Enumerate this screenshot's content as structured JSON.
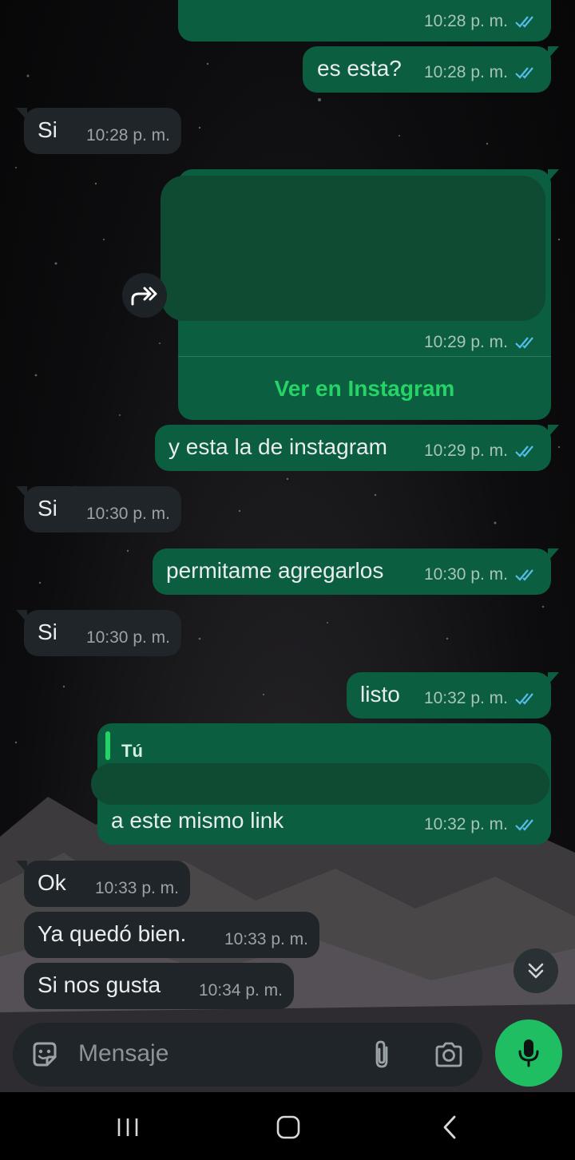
{
  "messages": [
    {
      "id": "m0",
      "direction": "out",
      "text": "",
      "time": "10:28 p. m.",
      "read": true
    },
    {
      "id": "m1",
      "direction": "out",
      "text": "es esta?",
      "time": "10:28 p. m.",
      "read": true
    },
    {
      "id": "m2",
      "direction": "in",
      "text": "Si",
      "time": "10:28 p. m."
    },
    {
      "id": "m3",
      "direction": "out",
      "text": "",
      "time": "10:29 p. m.",
      "read": true,
      "link_label": "Ver en Instagram"
    },
    {
      "id": "m4",
      "direction": "out",
      "text": "y esta la de instagram",
      "time": "10:29 p. m.",
      "read": true
    },
    {
      "id": "m5",
      "direction": "in",
      "text": "Si",
      "time": "10:30 p. m."
    },
    {
      "id": "m6",
      "direction": "out",
      "text": "permitame agregarlos",
      "time": "10:30 p. m.",
      "read": true
    },
    {
      "id": "m7",
      "direction": "in",
      "text": "Si",
      "time": "10:30 p. m."
    },
    {
      "id": "m8",
      "direction": "out",
      "text": "listo",
      "time": "10:32 p. m.",
      "read": true
    },
    {
      "id": "m9",
      "direction": "out",
      "text": "a este mismo link",
      "time": "10:32 p. m.",
      "read": true,
      "reply_to_name": "Tú"
    },
    {
      "id": "m10",
      "direction": "in",
      "text": "Ok",
      "time": "10:33 p. m."
    },
    {
      "id": "m11",
      "direction": "in",
      "text": "Ya quedó bien.",
      "time": "10:33 p. m."
    },
    {
      "id": "m12",
      "direction": "in",
      "text": "Si nos gusta",
      "time": "10:34 p. m."
    }
  ],
  "composer": {
    "placeholder": "Mensaje",
    "icons": [
      "sticker-icon",
      "attach-icon",
      "camera-icon",
      "mic-icon"
    ]
  },
  "colors": {
    "outgoing_bubble": "#0b5e3f",
    "incoming_bubble": "#1f2528",
    "accent": "#25d366",
    "read_ticks": "#53bdeb"
  },
  "navbar": {
    "icons": [
      "recent-apps-icon",
      "home-icon",
      "back-icon"
    ]
  }
}
